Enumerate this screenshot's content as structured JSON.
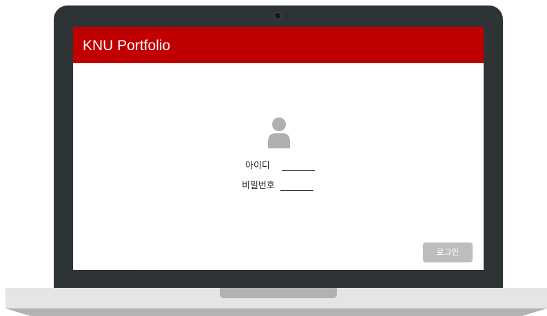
{
  "app": {
    "title": "KNU Portfolio"
  },
  "login_form": {
    "id_label": "아이디",
    "password_label": "비밀번호",
    "login_button": "로그인"
  },
  "icons": {
    "camera": "camera-icon",
    "avatar": "user-icon"
  },
  "colors": {
    "header": "#c00000",
    "bezel": "#2e3336",
    "button": "#bdbdbd",
    "avatar": "#b0b0b0"
  }
}
